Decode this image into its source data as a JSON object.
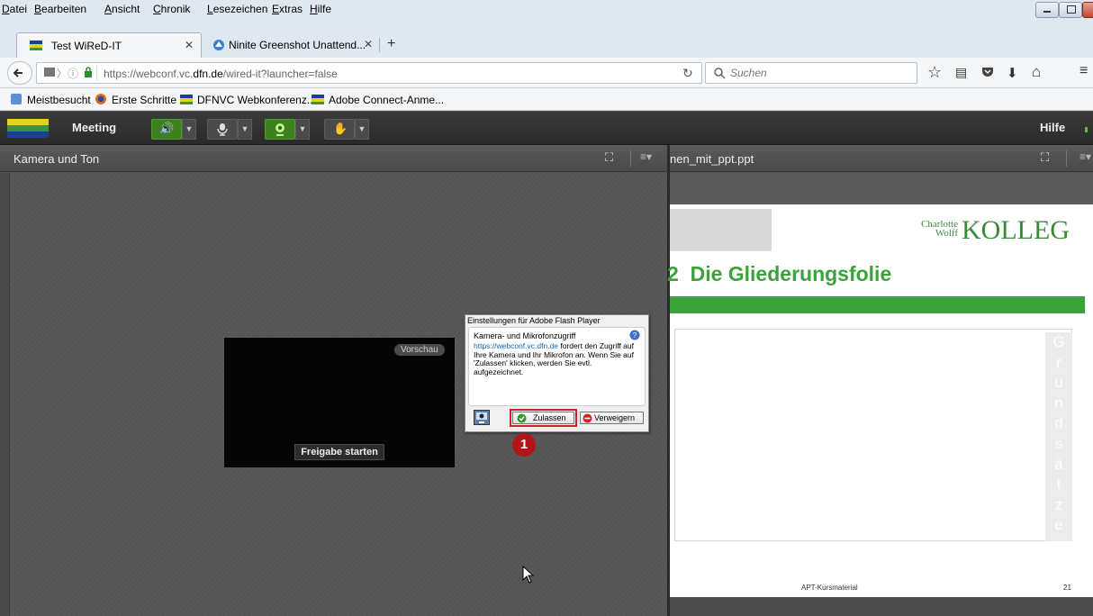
{
  "menu": [
    "Datei",
    "Bearbeiten",
    "Ansicht",
    "Chronik",
    "Lesezeichen",
    "Extras",
    "Hilfe"
  ],
  "tabs": [
    {
      "label": "Test WiReD-IT",
      "active": true
    },
    {
      "label": "Ninite Greenshot Unattend...",
      "active": false
    }
  ],
  "url": {
    "prefix": "https://webconf.vc.",
    "domain": "dfn.de",
    "path": "/wired-it?launcher=false"
  },
  "search": {
    "placeholder": "Suchen"
  },
  "bookmarks": [
    "Meistbesucht",
    "Erste Schritte",
    "DFNVC Webkonferenz...",
    "Adobe Connect-Anme..."
  ],
  "connect": {
    "meeting_label": "Meeting",
    "help_label": "Hilfe"
  },
  "left_panel": {
    "title": "Kamera und Ton",
    "preview_badge": "Vorschau",
    "share_button": "Freigabe starten"
  },
  "flash_dialog": {
    "title": "Einstellungen für Adobe Flash Player",
    "heading": "Kamera- und Mikrofonzugriff",
    "link": "https://webconf.vc.dfn.de",
    "body": " fordert den Zugriff auf Ihre Kamera und Ihr Mikrofon an. Wenn Sie auf 'Zulassen' klicken, werden Sie evtl. aufgezeichnet.",
    "allow": "Zulassen",
    "deny": "Verweigern"
  },
  "callout_number": "1",
  "right_panel": {
    "title": "nen_mit_ppt.ppt",
    "slide": {
      "logo_small_top": "Charlotte",
      "logo_small_bottom": "Wolff",
      "logo_big": "KOLLEG",
      "title_number": "2",
      "title": "Die Gliederungsfolie",
      "vertical_text": [
        "G",
        "r",
        "u",
        "n",
        "d",
        "s",
        "ä",
        "t",
        "z",
        "e"
      ],
      "footer": "APT-Kursmaterial",
      "page": "21"
    }
  },
  "colors": {
    "slide_green": "#3aa33a",
    "callout_red": "#b0151a",
    "link_blue": "#1565c0"
  }
}
